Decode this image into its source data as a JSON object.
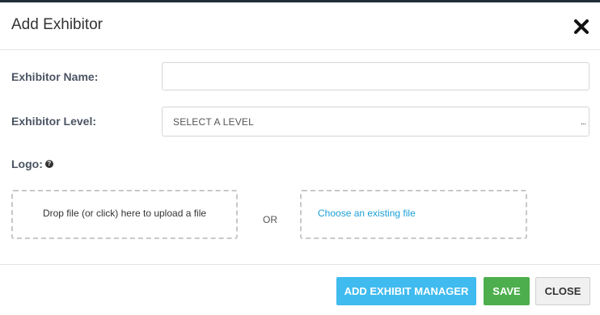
{
  "modal": {
    "title": "Add Exhibitor"
  },
  "form": {
    "name_label": "Exhibitor Name:",
    "name_value": "",
    "name_placeholder": "",
    "level_label": "Exhibitor Level:",
    "level_value": "SELECT A LEVEL",
    "level_ellipsis": "...",
    "logo_label": "Logo:",
    "help_glyph": "?"
  },
  "logo": {
    "upload_text": "Drop file (or click) here to upload a file",
    "or_text": "OR",
    "choose_text": "Choose an existing file"
  },
  "buttons": {
    "add_manager": "ADD EXHIBIT MANAGER",
    "save": "SAVE",
    "close": "CLOSE"
  },
  "colors": {
    "accent_blue": "#3fbbef",
    "save_green": "#4cae4c",
    "link_blue": "#1aa0d6"
  }
}
